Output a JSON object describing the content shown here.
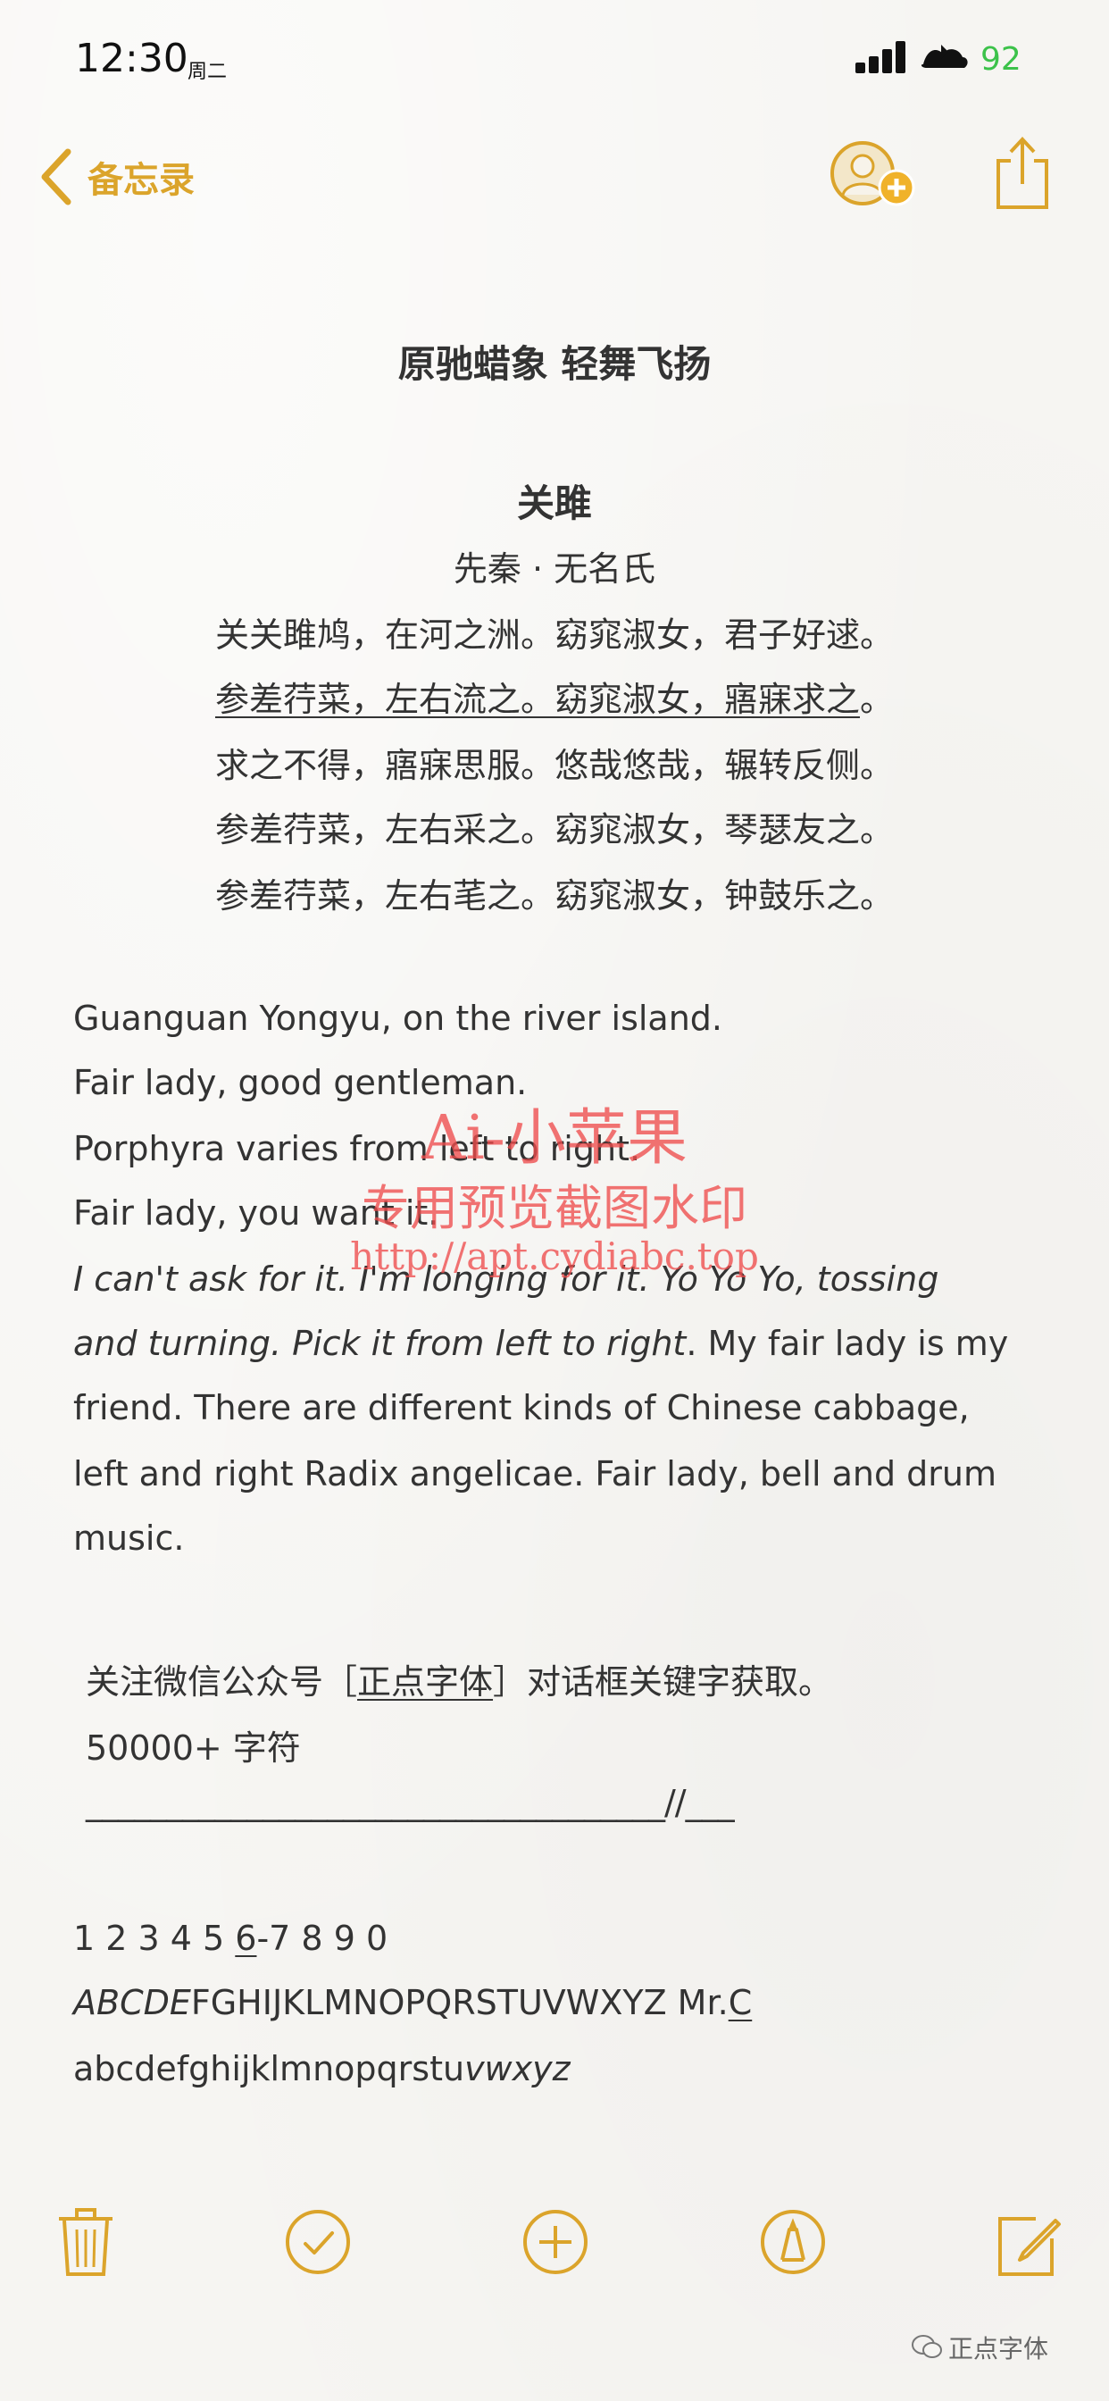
{
  "status_bar": {
    "time": "12:30",
    "day": "周二",
    "battery": "92",
    "accent_battery": "#3cc24a"
  },
  "nav": {
    "back_label": "备忘录",
    "accent": "#dba42b",
    "icons": [
      "chevron-left-icon",
      "add-person-icon",
      "share-icon"
    ]
  },
  "note": {
    "heading": "原驰蜡象 轻舞飞扬",
    "poem_title": "关雎",
    "poem_author": "先秦 · 无名氏",
    "poem_lines": [
      "关关雎鸠，在河之洲。窈窕淑女，君子好逑。",
      "参差荇菜，左右流之。窈窕淑女，寤寐求之",
      "。",
      "求之不得，寤寐思服。悠哉悠哉，辗转反侧。",
      "参差荇菜，左右采之。窈窕淑女，琴瑟友之。",
      "参差荇菜，左右芼之。窈窕淑女，钟鼓乐之。"
    ],
    "english_lines": [
      "Guanguan Yongyu, on the river island.",
      "Fair lady, good gentleman.",
      "Porphyra varies from left to right.",
      "Fair lady, you want it.",
      "I can't ask for it. I'm longing for it. Yo Yo Yo, tossing",
      "and turning. Pick it from left to right",
      ". My fair lady is my",
      "friend. There are different kinds of Chinese cabbage,",
      "left and right Radix angelicae. Fair lady, bell and drum",
      "music."
    ],
    "follow_prefix": "关注微信公众号［",
    "follow_brand": "正点字体",
    "follow_suffix": "］对话框关键字获取。",
    "char_count": "50000+ 字符",
    "underscore_line": "____________________________________//___",
    "digits_a": "1 2 3 4 5 ",
    "digits_b": "6",
    "digits_c": "-7 8 9 0",
    "upper_a": "ABCDE",
    "upper_b": "FGHIJKLMNOPQRSTUVWXYZ    Mr.",
    "upper_c": "C",
    "lower_a": "abcdefghijklmnopqrstu",
    "lower_b": "vwxyz"
  },
  "watermark": {
    "line1": "Ai-小苹果",
    "line2": "专用预览截图水印",
    "line3": "http://apt.cydiabc.top"
  },
  "toolbar": {
    "icons": [
      "trash-icon",
      "checklist-icon",
      "add-icon",
      "markup-pen-icon",
      "compose-icon"
    ]
  },
  "footer": {
    "wechat_label": "正点字体"
  }
}
